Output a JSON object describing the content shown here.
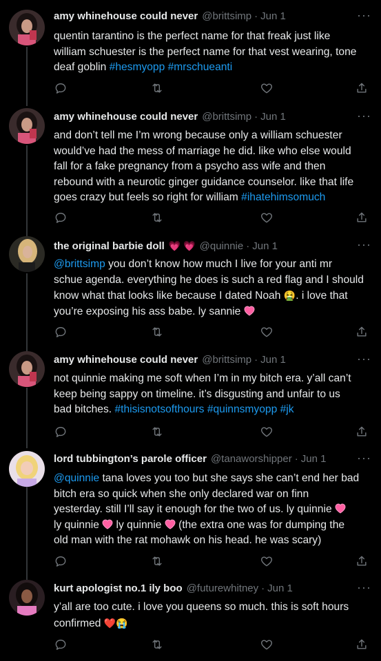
{
  "tweets": [
    {
      "name": "amy whinehouse could never",
      "handle": "@brittsimp",
      "sep": "·",
      "date": "Jun 1",
      "lines": [
        [
          {
            "t": "quentin tarantino is the perfect name for that freak just like"
          }
        ],
        [
          {
            "t": "william schuester is the perfect name for that vest wearing, tone"
          }
        ],
        [
          {
            "t": "deaf goblin "
          },
          {
            "t": "#hesmyopp",
            "link": true
          },
          {
            "t": " "
          },
          {
            "t": "#mrschueanti",
            "link": true
          }
        ]
      ]
    },
    {
      "name": "amy whinehouse could never",
      "handle": "@brittsimp",
      "sep": "·",
      "date": "Jun 1",
      "lines": [
        [
          {
            "t": "and don’t tell me I’m wrong because only a william schuester"
          }
        ],
        [
          {
            "t": "would’ve had the mess of marriage he did. like who else would"
          }
        ],
        [
          {
            "t": "fall for a fake pregnancy from a psycho ass wife and then"
          }
        ],
        [
          {
            "t": "rebound with a neurotic ginger guidance counselor. like that life"
          }
        ],
        [
          {
            "t": "goes crazy but feels so right for william "
          },
          {
            "t": "#ihatehimsomuch",
            "link": true
          }
        ]
      ]
    },
    {
      "name": "the original barbie doll",
      "name_emoji": "💗 💗",
      "handle": "@quinnie",
      "sep": "·",
      "date": "Jun 1",
      "lines": [
        [
          {
            "t": "@brittsimp",
            "link": true
          },
          {
            "t": " you don’t know how much I live for your anti mr"
          }
        ],
        [
          {
            "t": "schue agenda. everything he does is such a red flag and I should"
          }
        ],
        [
          {
            "t": "know what that looks like because I dated Noah "
          },
          {
            "t": "🤮",
            "emoji": true
          },
          {
            "t": ". i love that"
          }
        ],
        [
          {
            "t": "you’re exposing his ass babe. ly sannie "
          },
          {
            "t": "💗",
            "emoji": true
          }
        ]
      ]
    },
    {
      "name": "amy whinehouse could never",
      "handle": "@brittsimp",
      "sep": "·",
      "date": "Jun 1",
      "lines": [
        [
          {
            "t": "not quinnie making me soft when I’m in my bitch era. y’all can’t"
          }
        ],
        [
          {
            "t": "keep being sappy on timeline. it’s disgusting and unfair to us"
          }
        ],
        [
          {
            "t": "bad bitches. "
          },
          {
            "t": "#thisisnotsofthours",
            "link": true
          },
          {
            "t": " "
          },
          {
            "t": "#quinnsmyopp",
            "link": true
          },
          {
            "t": " "
          },
          {
            "t": "#jk",
            "link": true
          }
        ]
      ]
    },
    {
      "name": "lord tubbington’s parole officer",
      "handle": "@tanaworshipper",
      "sep": "·",
      "date": "Jun 1",
      "lines": [
        [
          {
            "t": "@quinnie",
            "link": true
          },
          {
            "t": " tana loves you too but she says she can’t end her bad"
          }
        ],
        [
          {
            "t": "bitch era so quick when she only declared war on finn"
          }
        ],
        [
          {
            "t": "yesterday. still I’ll say it enough for the two of us. ly quinnie "
          },
          {
            "t": "💗",
            "emoji": true
          }
        ],
        [
          {
            "t": "ly quinnie "
          },
          {
            "t": "💗",
            "emoji": true
          },
          {
            "t": " ly quinnie "
          },
          {
            "t": "💗",
            "emoji": true
          },
          {
            "t": " (the extra one was for dumping the"
          }
        ],
        [
          {
            "t": "old man with the rat mohawk on his head. he was scary)"
          }
        ]
      ]
    },
    {
      "name": "kurt apologist no.1 ily boo",
      "handle": "@futurewhitney",
      "sep": "·",
      "date": "Jun 1",
      "lines": [
        [
          {
            "t": "y’all are too cute. i love you queens so much. this is soft hours"
          }
        ],
        [
          {
            "t": "confirmed "
          },
          {
            "t": "❤️",
            "emoji": true
          },
          {
            "t": "😭",
            "emoji": true
          }
        ]
      ]
    }
  ],
  "icons": {
    "reply": "reply-icon",
    "retweet": "retweet-icon",
    "like": "like-icon",
    "share": "share-icon",
    "more": "more-icon"
  },
  "more_glyph": "···",
  "colors": {
    "background": "#000000",
    "text": "#e7e9ea",
    "muted": "#71767b",
    "link": "#1d9bf0",
    "thread_line": "#333639"
  }
}
